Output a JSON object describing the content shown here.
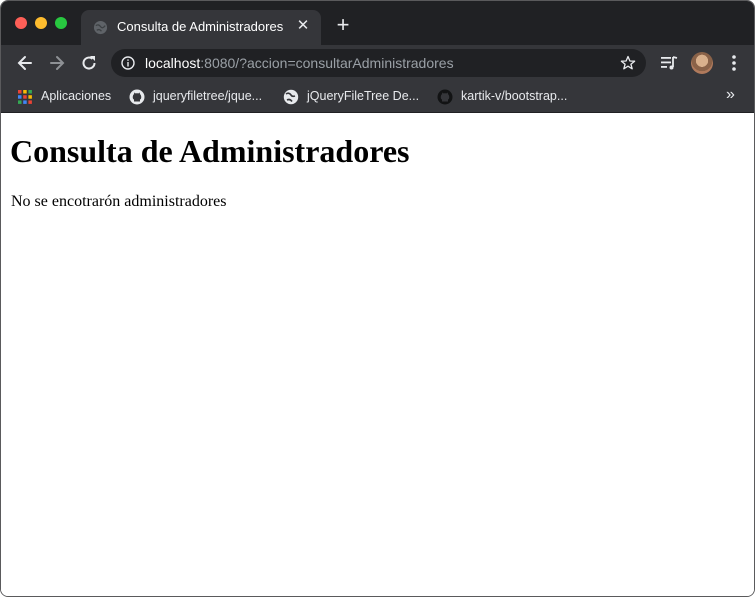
{
  "browser": {
    "tab": {
      "title": "Consulta de Administradores",
      "close_glyph": "✕",
      "favicon": "globe-icon"
    },
    "new_tab_glyph": "+",
    "address_bar": {
      "host": "localhost",
      "rest": ":8080/?accion=consultarAdministradores"
    },
    "bookmarks": [
      {
        "label": "Aplicaciones",
        "icon": "apps-grid-icon"
      },
      {
        "label": "jqueryfiletree/jque...",
        "icon": "github-icon"
      },
      {
        "label": "jQueryFileTree De...",
        "icon": "globe-icon"
      },
      {
        "label": "kartik-v/bootstrap...",
        "icon": "github-icon"
      }
    ],
    "bookmarks_overflow_glyph": "»"
  },
  "page": {
    "title": "Consulta de Administradores",
    "message": "No se encotrarón administradores"
  }
}
